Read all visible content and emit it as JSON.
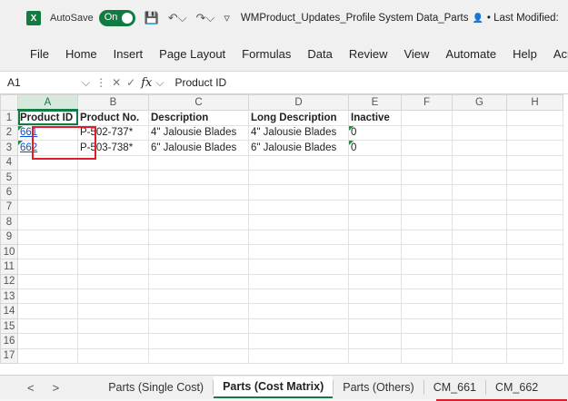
{
  "titlebar": {
    "logo": "X",
    "autosave_label": "AutoSave",
    "toggle_label": "On",
    "doc_title": "WMProduct_Updates_Profile System Data_Parts",
    "last_modified": "• Last Modified:"
  },
  "menu": [
    "File",
    "Home",
    "Insert",
    "Page Layout",
    "Formulas",
    "Data",
    "Review",
    "View",
    "Automate",
    "Help",
    "Acrol"
  ],
  "formula_bar": {
    "name_box": "A1",
    "fx": "fx",
    "value": "Product ID"
  },
  "columns": [
    "A",
    "B",
    "C",
    "D",
    "E",
    "F",
    "G",
    "H"
  ],
  "rows": [
    [
      "Product ID",
      "Product No.",
      "Description",
      "Long Description",
      "Inactive",
      "",
      "",
      ""
    ],
    [
      "661",
      "P-502-737*",
      "4\" Jalousie Blades",
      "4\" Jalousie Blades",
      "0",
      "",
      "",
      ""
    ],
    [
      "662",
      "P-503-738*",
      "6\" Jalousie Blades",
      "6\" Jalousie Blades",
      "0",
      "",
      "",
      ""
    ]
  ],
  "row_numbers": [
    "1",
    "2",
    "3",
    "4",
    "5",
    "6",
    "7",
    "8",
    "9",
    "10",
    "11",
    "12",
    "13",
    "14",
    "15",
    "16",
    "17"
  ],
  "sheet_tabs": [
    "Parts (Single Cost)",
    "Parts (Cost Matrix)",
    "Parts (Others)",
    "CM_661",
    "CM_662"
  ],
  "active_tab": "Parts (Cost Matrix)",
  "nav": {
    "prev": "<",
    "next": ">"
  },
  "colors": {
    "excel_green": "#107c41",
    "highlight_red": "#e01e2a",
    "link_blue": "#0b4fd6"
  }
}
